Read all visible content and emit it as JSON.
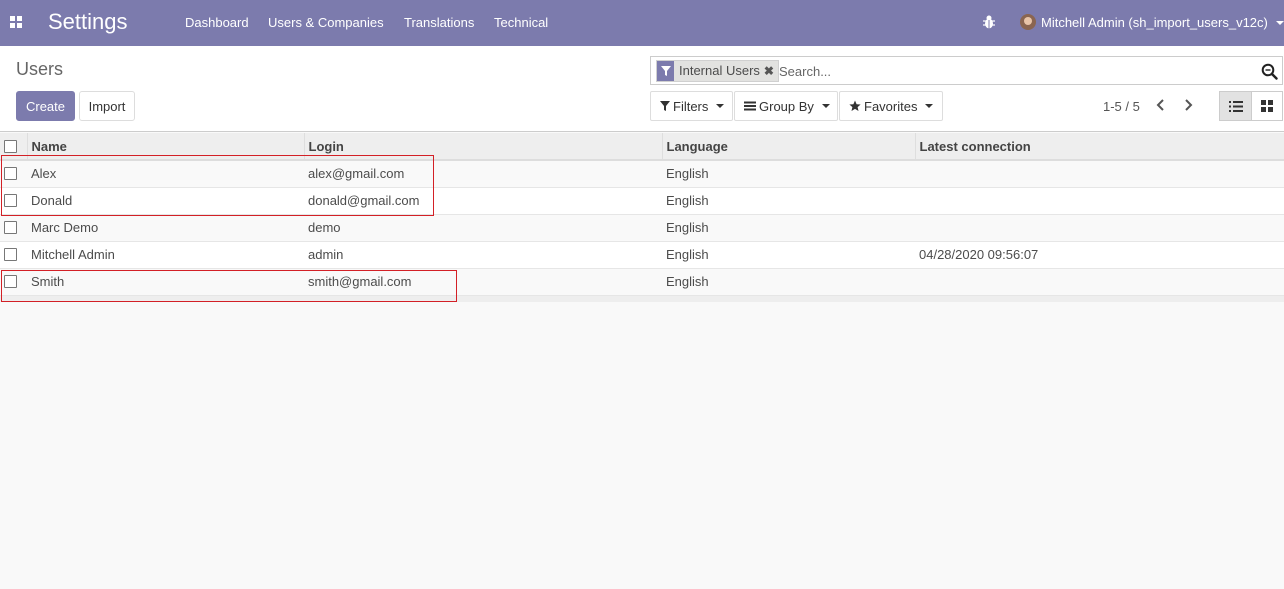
{
  "navbar": {
    "brand": "Settings",
    "menu": [
      "Dashboard",
      "Users & Companies",
      "Translations",
      "Technical"
    ],
    "user": "Mitchell Admin (sh_import_users_v12c)"
  },
  "control_panel": {
    "breadcrumb": "Users",
    "create_label": "Create",
    "import_label": "Import",
    "search": {
      "facet_label": "Internal Users",
      "placeholder": "Search..."
    },
    "filters_label": "Filters",
    "groupby_label": "Group By",
    "favorites_label": "Favorites",
    "pager": "1-5 / 5"
  },
  "table": {
    "columns": [
      "Name",
      "Login",
      "Language",
      "Latest connection"
    ],
    "rows": [
      {
        "name": "Alex",
        "login": "alex@gmail.com",
        "language": "English",
        "latest": ""
      },
      {
        "name": "Donald",
        "login": "donald@gmail.com",
        "language": "English",
        "latest": ""
      },
      {
        "name": "Marc Demo",
        "login": "demo",
        "language": "English",
        "latest": ""
      },
      {
        "name": "Mitchell Admin",
        "login": "admin",
        "language": "English",
        "latest": "04/28/2020 09:56:07"
      },
      {
        "name": "Smith",
        "login": "smith@gmail.com",
        "language": "English",
        "latest": ""
      }
    ]
  },
  "colors": {
    "brand": "#7c7bad",
    "annotation": "#d32026"
  },
  "icons": [
    "apps-icon",
    "bug-icon",
    "filter-icon",
    "search-icon",
    "menu-lines-icon",
    "star-icon",
    "chevron-left-icon",
    "chevron-right-icon",
    "list-view-icon",
    "kanban-view-icon"
  ]
}
